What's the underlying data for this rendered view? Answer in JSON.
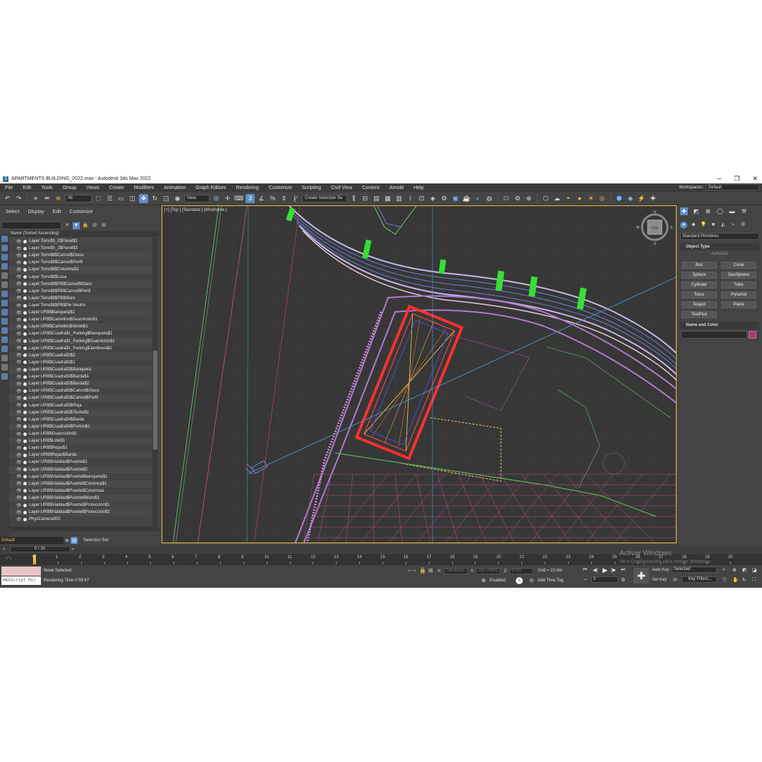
{
  "window": {
    "title": "APARTMENTS BUILDING_2022.max - Autodesk 3ds Max 2022",
    "minimize": "─",
    "maximize": "❐",
    "close": "✕"
  },
  "menu": [
    "File",
    "Edit",
    "Tools",
    "Group",
    "Views",
    "Create",
    "Modifiers",
    "Animation",
    "Graph Editors",
    "Rendering",
    "Customize",
    "Scripting",
    "Civil View",
    "Content",
    "Arnold",
    "Help"
  ],
  "workspace": {
    "label": "Workspaces:",
    "value": "Default"
  },
  "toolbar": {
    "filter_dropdown": "All",
    "coord_dropdown": "View",
    "snap_label": "3",
    "selection_set_dropdown": "Create Selection Se"
  },
  "scene_explorer": {
    "menu": [
      "Select",
      "Display",
      "Edit",
      "Customize"
    ],
    "column_header": "Name (Sorted Ascending)",
    "rows": [
      "Layer:Torre$5_2$Panel$1",
      "Layer:Torre$5_2$Panel$3",
      "Layer:Torre$8$Cancel$Glass",
      "Layer:Torre$8$Cancel$Perfil",
      "Layer:Torre$8$Columna$1",
      "Layer:Torre$8$Losa",
      "Layer:Torre$8$PB$Cancel$Glass",
      "Layer:Torre$8$PB$Cancel$Perfil",
      "Layer:Torre$8$PB$Muro",
      "Layer:Torre$8$PB$Pie Neutro",
      "Layer:URB$Banqueta$1",
      "Layer:URB$Camellón$Guarnición$1",
      "Layer:URB$Camellón$Verde$1",
      "Layer:URB$Cuadra$1_Parking$Banqueta$1",
      "Layer:URB$Cuadra$1_Parking$Guarnición$1",
      "Layer:URB$Cuadra$1_Parking$Jardinera$1",
      "Layer:URB$Cuadra$2$2",
      "Layer:URB$Cuadra$3$1",
      "Layer:URB$Cuadra$3$Banqueta",
      "Layer:URB$Cuadra$3$Barda$1",
      "Layer:URB$Cuadra$3$Barda$2",
      "Layer:URB$Cuadra$3$Cancel$Glass",
      "Layer:URB$Cuadra$3$Cancel$Perfil",
      "Layer:URB$Cuadra$3$Reja",
      "Layer:URB$Cuadra$3$Techo$1",
      "Layer:URB$Cuadra$4$Barda",
      "Layer:URB$Cuadra$4$Portón$1",
      "Layer:URB$Guarnición$1",
      "Layer:URB$Lote$1",
      "Layer:URB$Rejas$1",
      "Layer:URB$Rejas$Barda",
      "Layer:URB$Vialidad$Puente$1",
      "Layer:URB$Vialidad$Puente$2",
      "Layer:URB$Vialidad$Puente$banqueta$1",
      "Layer:URB$Vialidad$Puente$Columna$1",
      "Layer:URB$Vialidad$Puente$Columnas",
      "Layer:URB$Vialidad$Puente$Muro$1",
      "Layer:URB$Vialidad$Puente$Protección$1",
      "Layer:URB$Vialidad$Puente$Protección$2",
      "PhysCamera002"
    ]
  },
  "layer_bar": {
    "layer": "Default",
    "selection_set": "Selection Set:"
  },
  "viewport": {
    "label": "[+] [Top ] [Standard ] [Wireframe ]",
    "viewcube": "TOP",
    "north": "N",
    "south": "S",
    "east": "E",
    "west": "W"
  },
  "command_panel": {
    "category_dropdown": "Standard Primitives",
    "object_type_title": "Object Type",
    "autogrid": "AutoGrid",
    "primitives": [
      "Box",
      "Cone",
      "Sphere",
      "GeoSphere",
      "Cylinder",
      "Tube",
      "Torus",
      "Pyramid",
      "Teapot",
      "Plane",
      "TextPlus"
    ],
    "name_color_title": "Name and Color",
    "color": "#c0307a"
  },
  "time_slider": {
    "value": "0 / 30"
  },
  "trackbar": {
    "ticks": [
      "0",
      "1",
      "2",
      "3",
      "4",
      "5",
      "6",
      "7",
      "8",
      "9",
      "10",
      "11",
      "12",
      "13",
      "14",
      "15",
      "16",
      "17",
      "18",
      "19",
      "20",
      "21",
      "22",
      "23",
      "24",
      "25",
      "26",
      "27",
      "28",
      "29",
      "30"
    ]
  },
  "status": {
    "maxscript": "MAXScript Mir",
    "selection": "None Selected",
    "render_time": "Rendering Time  0:09:47",
    "x_label": "X:",
    "x_value": "784.633m",
    "y_label": "Y:",
    "y_value": "287.299m",
    "z_label": "Z:",
    "z_value": "0.0m",
    "grid": "Grid = 10.0m",
    "enabled": "Enabled:",
    "add_time_tag": "Add Time Tag",
    "auto_key": "Auto Key",
    "key_mode": "Selected",
    "set_key": "Set Key",
    "key_filters": "Key Filters...",
    "frame": "0"
  },
  "watermark": {
    "line1": "Activar Windows",
    "line2": "Ve a Configuración para activar Windows."
  }
}
